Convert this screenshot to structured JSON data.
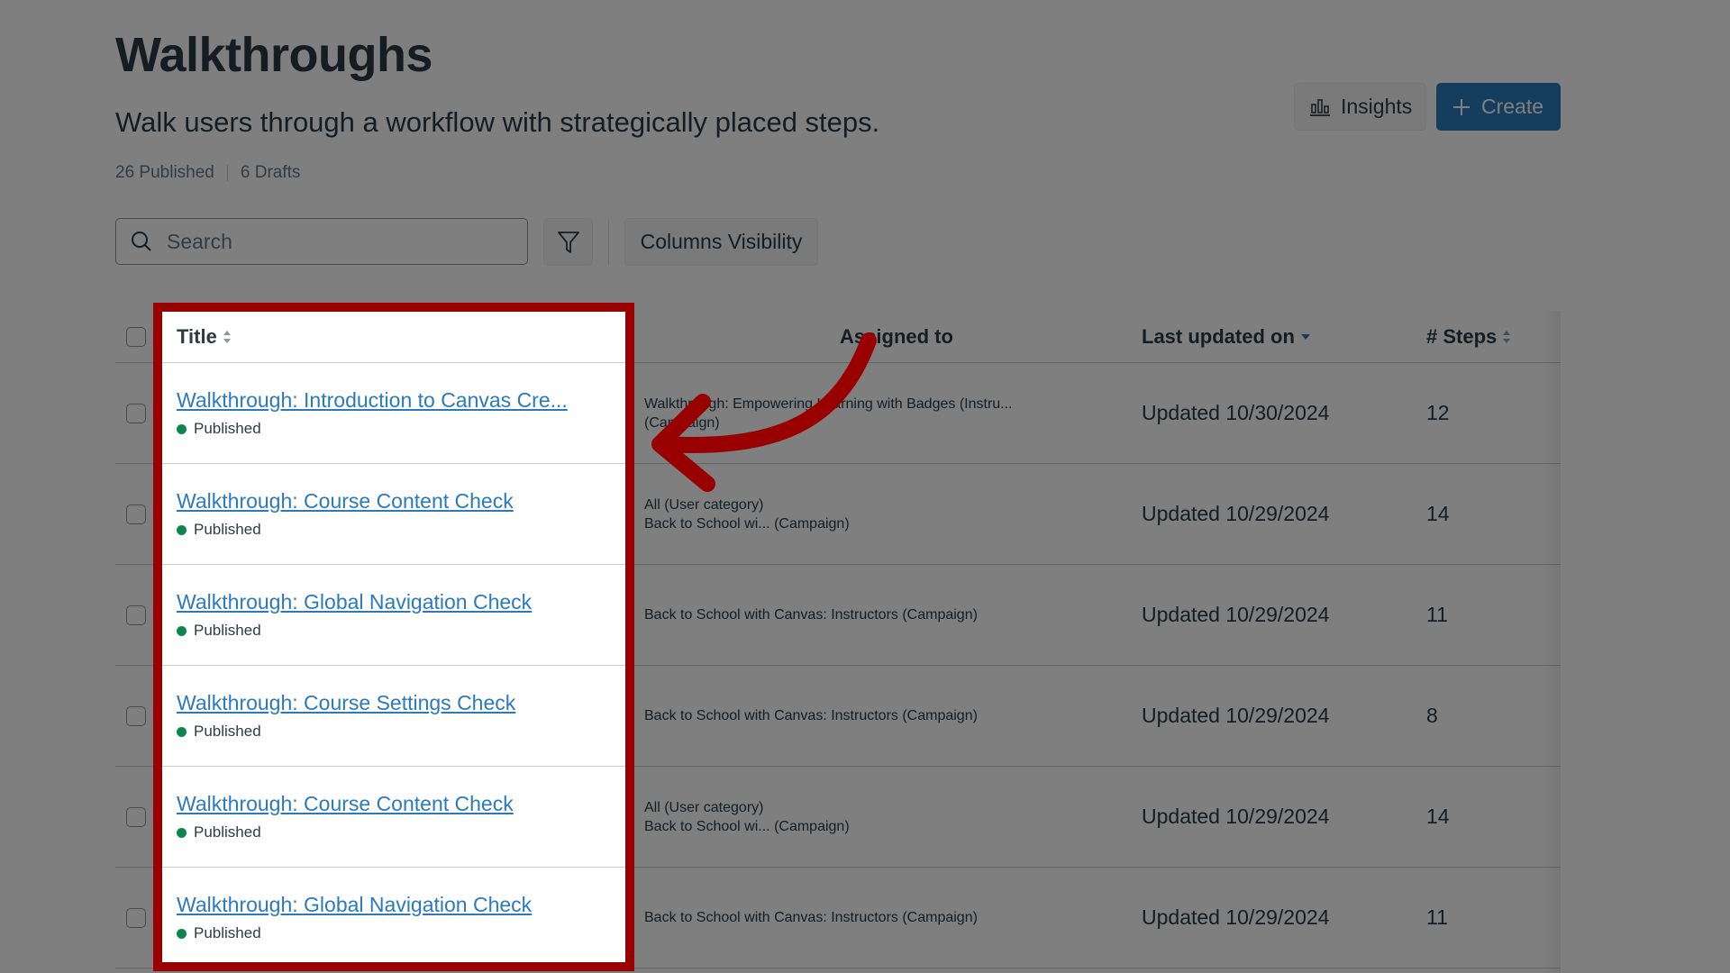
{
  "header": {
    "title": "Walkthroughs",
    "subtitle": "Walk users through a workflow with strategically placed steps.",
    "published_count": "26 Published",
    "drafts_count": "6 Drafts"
  },
  "actions": {
    "insights_label": "Insights",
    "insights_icon": "bar-chart-icon",
    "create_label": "Create",
    "create_icon": "plus-icon"
  },
  "toolbar": {
    "search_placeholder": "Search",
    "search_value": "",
    "filter_icon": "filter-funnel-icon",
    "columns_visibility_label": "Columns Visibility"
  },
  "table": {
    "columns": {
      "title": "Title",
      "assigned_to": "Assigned to",
      "last_updated": "Last updated on",
      "steps": "# Steps"
    },
    "sort": {
      "column": "last_updated",
      "direction": "descending"
    },
    "rows": [
      {
        "title": "Walkthrough: Introduction to Canvas Cre...",
        "status": "Published",
        "assigned": [
          "Walkthrough: Empowering Learning with Badges (Instru...",
          "(Campaign)"
        ],
        "updated": "Updated 10/30/2024",
        "steps": "12"
      },
      {
        "title": "Walkthrough: Course Content Check",
        "status": "Published",
        "assigned": [
          "All (User category)",
          "Back to School wi... (Campaign)"
        ],
        "updated": "Updated 10/29/2024",
        "steps": "14"
      },
      {
        "title": "Walkthrough: Global Navigation Check",
        "status": "Published",
        "assigned": [
          "Back to School with Canvas: Instructors (Campaign)"
        ],
        "updated": "Updated 10/29/2024",
        "steps": "11"
      },
      {
        "title": "Walkthrough: Course Settings Check",
        "status": "Published",
        "assigned": [
          "Back to School with Canvas: Instructors (Campaign)"
        ],
        "updated": "Updated 10/29/2024",
        "steps": "8"
      },
      {
        "title": "Walkthrough: Course Content Check",
        "status": "Published",
        "assigned": [
          "All (User category)",
          "Back to School wi... (Campaign)"
        ],
        "updated": "Updated 10/29/2024",
        "steps": "14"
      },
      {
        "title": "Walkthrough: Global Navigation Check",
        "status": "Published",
        "assigned": [
          "Back to School with Canvas: Instructors (Campaign)"
        ],
        "updated": "Updated 10/29/2024",
        "steps": "11"
      }
    ]
  },
  "annotation": {
    "highlight": "Title column",
    "highlight_color": "#990000",
    "arrow_color": "#990000"
  },
  "colors": {
    "primary": "#2b7abc",
    "text": "#2d3b45",
    "published": "#0b874b"
  }
}
